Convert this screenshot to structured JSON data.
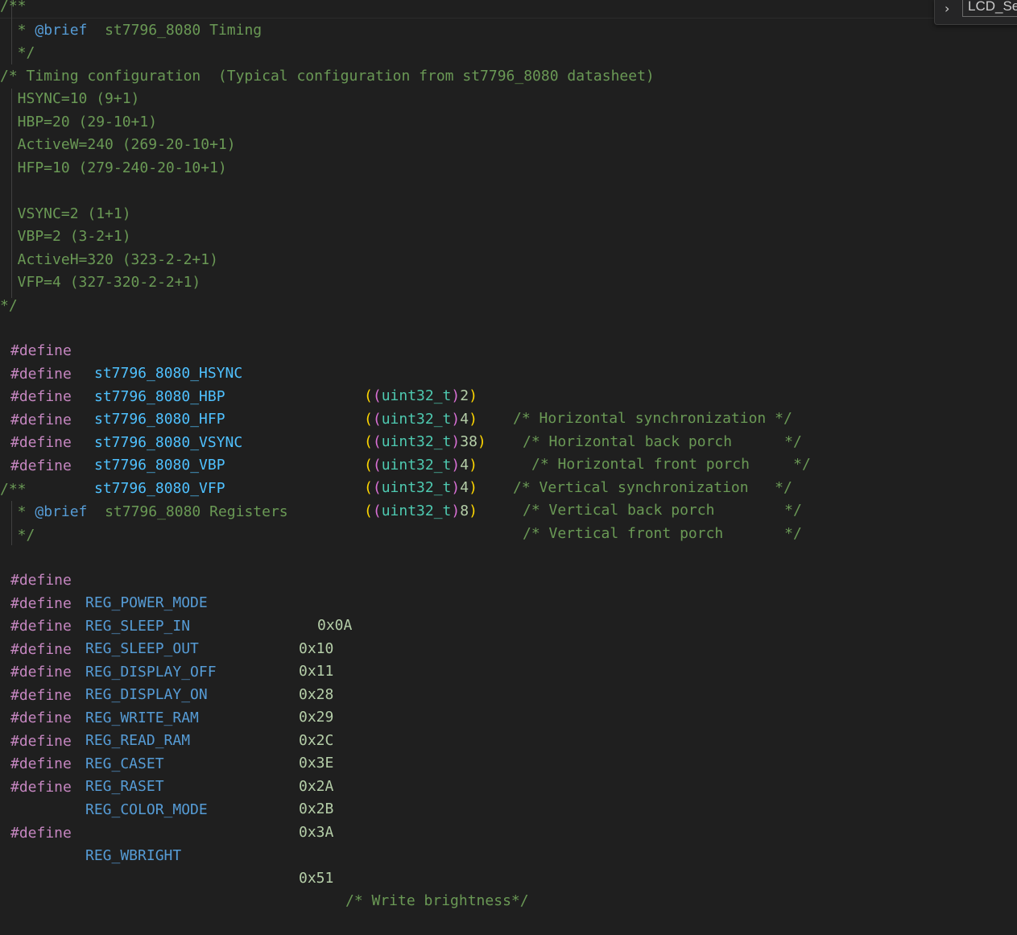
{
  "breadcrumb": {
    "label": "LCD_Se"
  },
  "code": {
    "l00": "/**",
    "l01_pre": "  * ",
    "l01_tag": "@brief",
    "l01_txt": "  st7796_8080 Timing",
    "l02": "  */",
    "l03": "/* Timing configuration  (Typical configuration from st7796_8080 datasheet)",
    "l04": "  HSYNC=10 (9+1)",
    "l05": "  HBP=20 (29-10+1)",
    "l06": "  ActiveW=240 (269-20-10+1)",
    "l07": "  HFP=10 (279-240-20-10+1)",
    "l08": "",
    "l09": "  VSYNC=2 (1+1)",
    "l10": "  VBP=2 (3-2+1)",
    "l11": "  ActiveH=320 (323-2-2+1)",
    "l12": "  VFP=4 (327-320-2-2+1)",
    "l13": "*/",
    "directive": "#define",
    "cast_type": "uint32_t",
    "t14_name": "st7796_8080_HSYNC",
    "t14_val": "2",
    "t14_cmt": "/* Horizontal synchronization */",
    "t15_name": "st7796_8080_HBP",
    "t15_val": "4",
    "t15_cmt": "/* Horizontal back porch      */",
    "t16_name": "st7796_8080_HFP",
    "t16_val": "38",
    "t16_cmt": "/* Horizontal front porch     */",
    "t17_name": "st7796_8080_VSYNC",
    "t17_val": "4",
    "t17_cmt": "/* Vertical synchronization   */",
    "t18_name": "st7796_8080_VBP",
    "t18_val": "4",
    "t18_cmt": "/* Vertical back porch        */",
    "t19_name": "st7796_8080_VFP",
    "t19_val": "8",
    "t19_cmt": "/* Vertical front porch       */",
    "l21": "/**",
    "l22_pre": "  * ",
    "l22_tag": "@brief",
    "l22_txt": "  st7796_8080 Registers",
    "l23": "  */",
    "r24_name": "REG_POWER_MODE",
    "r24_val": "0x0A",
    "r25_name": "REG_SLEEP_IN",
    "r25_val": "0x10",
    "r26_name": "REG_SLEEP_OUT",
    "r26_val": "0x11",
    "r27_name": "REG_DISPLAY_OFF",
    "r27_val": "0x28",
    "r28_name": "REG_DISPLAY_ON",
    "r28_val": "0x29",
    "r29_name": "REG_WRITE_RAM",
    "r29_val": "0x2C",
    "r30_name": "REG_READ_RAM",
    "r30_val": "0x3E",
    "r31_name": "REG_CASET",
    "r31_val": "0x2A",
    "r32_name": "REG_RASET",
    "r32_val": "0x2B",
    "r33_name": "REG_COLOR_MODE",
    "r33_val": "0x3A",
    "r35_name": "REG_WBRIGHT",
    "r35_val": "0x51",
    "r35_cmt": "/* Write brightness*/"
  }
}
